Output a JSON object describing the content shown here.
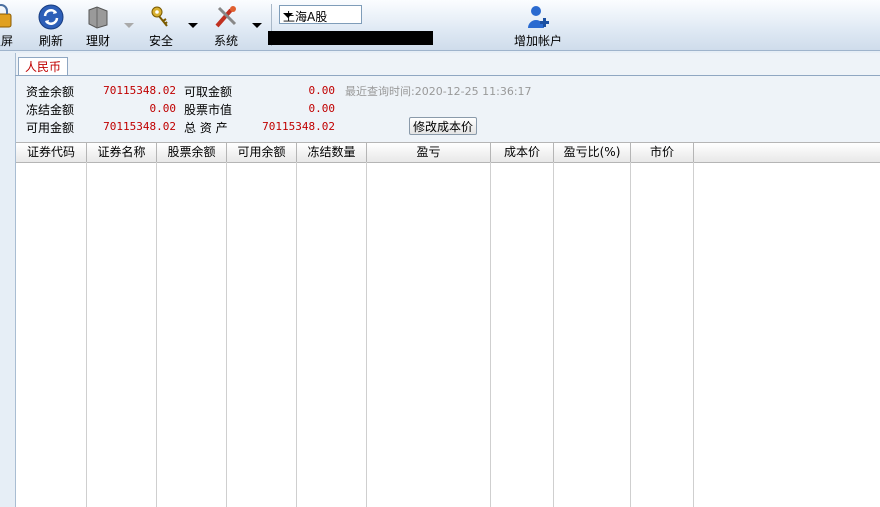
{
  "toolbar": {
    "items": [
      {
        "label": "锁屏",
        "icon": "lock-screen-icon"
      },
      {
        "label": "刷新",
        "icon": "refresh-icon"
      },
      {
        "label": "理财",
        "icon": "finance-icon"
      },
      {
        "label": "安全",
        "icon": "security-keys-icon"
      },
      {
        "label": "系统",
        "icon": "system-tools-icon"
      },
      {
        "label": "增加帐户",
        "icon": "add-account-icon"
      }
    ],
    "market_select": "上海A股"
  },
  "currency_tab": "人民币",
  "summary": {
    "funds_balance_label": "资金余额",
    "funds_balance": "70115348.02",
    "frozen_amount_label": "冻结金额",
    "frozen_amount": "0.00",
    "available_amount_label": "可用金额",
    "available_amount": "70115348.02",
    "withdrawable_label": "可取金额",
    "withdrawable": "0.00",
    "stock_value_label": "股票市值",
    "stock_value": "0.00",
    "total_assets_label": "总 资 产",
    "total_assets": "70115348.02",
    "last_query": "最近查询时间:2020-12-25 11:36:17",
    "modify_cost_button": "修改成本价"
  },
  "table": {
    "columns": [
      "证券代码",
      "证券名称",
      "股票余额",
      "可用余额",
      "冻结数量",
      "盈亏",
      "成本价",
      "盈亏比(%)",
      "市价"
    ]
  },
  "colors": {
    "value_red": "#c00000",
    "accent_blue": "#1f5fbf"
  }
}
